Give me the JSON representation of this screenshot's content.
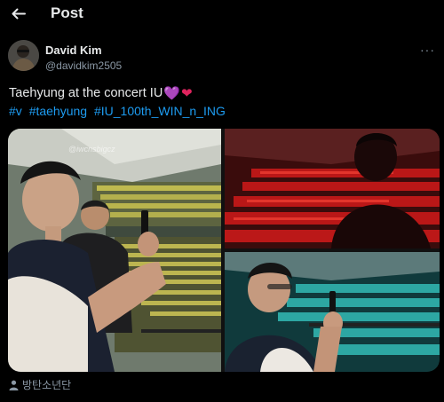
{
  "header": {
    "title": "Post",
    "back_icon": "arrow-left-icon"
  },
  "author": {
    "name": "David Kim",
    "handle": "@davidkim2505"
  },
  "post": {
    "text": "Taehyung at the concert IU",
    "hearts": [
      "💜",
      "❤"
    ],
    "heart_colors": [
      "#a66cd6",
      "#e0245e"
    ],
    "hashtags": [
      "#v",
      "#taehyung",
      "#IU_100th_WIN_n_ING"
    ],
    "media": [
      {
        "kind": "photo",
        "watermark": "@iwcnsbigcz"
      },
      {
        "kind": "photo"
      },
      {
        "kind": "photo"
      }
    ]
  },
  "footer": {
    "tagged": "방탄소년단",
    "icon": "person-icon"
  },
  "colors": {
    "link": "#1d9bf0",
    "muted": "#8b98a5",
    "background": "#000000"
  }
}
